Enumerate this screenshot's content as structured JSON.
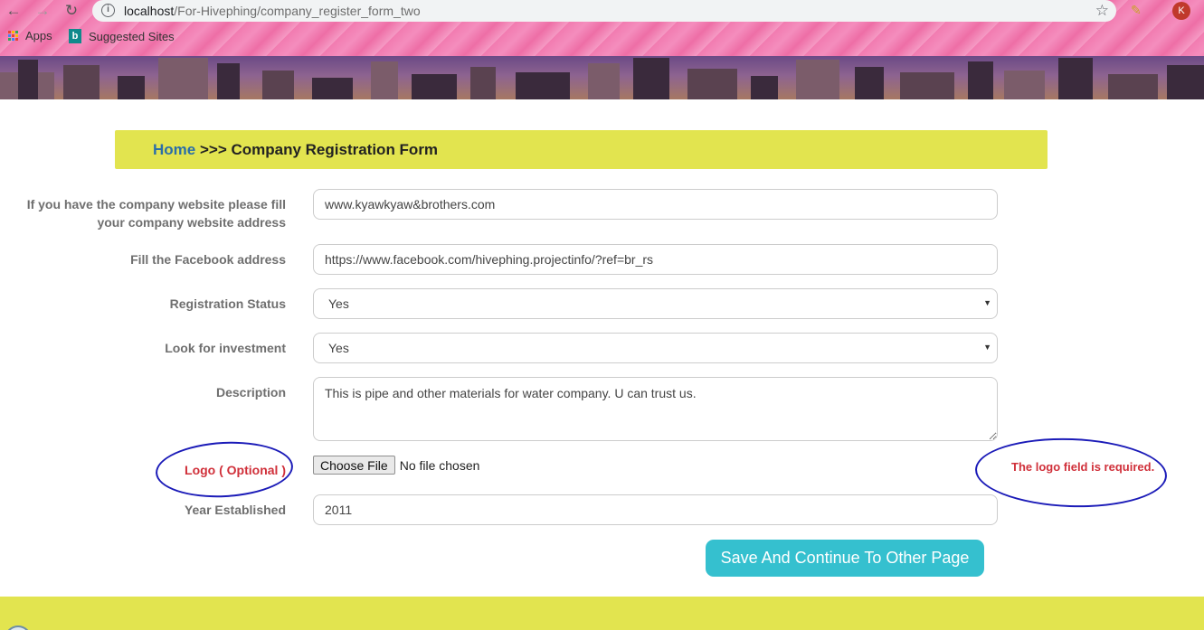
{
  "browser": {
    "url_host": "localhost",
    "url_path": "/For-Hivephing/company_register_form_two",
    "bookmarks": [
      {
        "label": "Apps",
        "icon": "apps-grid-icon"
      },
      {
        "label": "Suggested Sites",
        "icon": "bing-icon"
      }
    ],
    "bing_letter": "b",
    "avatar_letter": "K"
  },
  "breadcrumb": {
    "home": "Home",
    "separator": " >>> ",
    "current": "Company Registration Form"
  },
  "form": {
    "website": {
      "label_line1": "If you have the company website please fill",
      "label_line2": "your company website address",
      "value": "www.kyawkyaw&brothers.com"
    },
    "facebook": {
      "label": "Fill the Facebook address",
      "value": "https://www.facebook.com/hivephing.projectinfo/?ref=br_rs"
    },
    "registration_status": {
      "label": "Registration Status",
      "selected": "Yes"
    },
    "investment": {
      "label": "Look for investment",
      "selected": "Yes"
    },
    "description": {
      "label": "Description",
      "value": "This is pipe and other materials for water company. U can trust us."
    },
    "logo": {
      "label": "Logo ( Optional )",
      "button": "Choose File",
      "status": "No file chosen",
      "error": "The logo field is required."
    },
    "year": {
      "label": "Year Established",
      "value": "2011"
    },
    "submit_label": "Save And Continue To Other Page"
  },
  "colors": {
    "accent_bar": "#e2e44f",
    "home_link": "#2b6ea8",
    "error": "#d0303a",
    "submit": "#35c0cf",
    "annotation": "#1b1bb8"
  }
}
